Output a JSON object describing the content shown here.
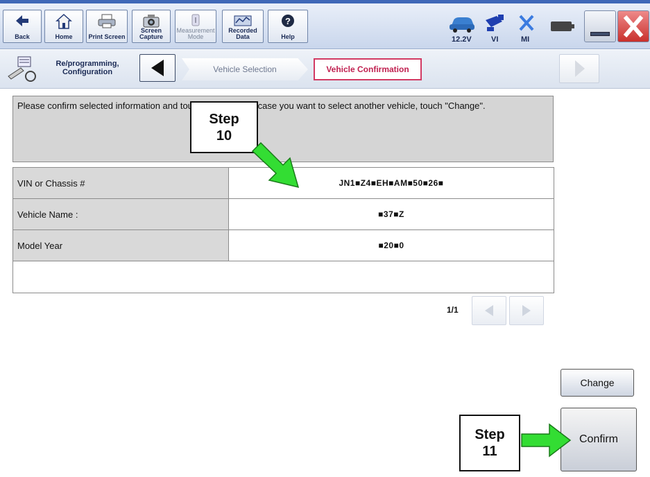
{
  "toolbar": {
    "buttons": [
      {
        "label": "Back",
        "icon": "back-arrow-icon"
      },
      {
        "label": "Home",
        "icon": "home-icon"
      },
      {
        "label": "Print Screen",
        "icon": "printer-icon"
      },
      {
        "label": "Screen Capture",
        "icon": "camera-icon"
      },
      {
        "label": "Measurement Mode",
        "icon": "gauge-icon",
        "disabled": true
      },
      {
        "label": "Recorded Data",
        "icon": "recorded-data-icon"
      },
      {
        "label": "Help",
        "icon": "help-icon"
      }
    ],
    "voltage": "12.2V",
    "vi_label": "VI",
    "mi_label": "MI"
  },
  "breadcrumb": {
    "repro_label": "Re/programming, Configuration",
    "vehicle_selection": "Vehicle Selection",
    "vehicle_confirmation": "Vehicle Confirmation"
  },
  "main": {
    "message": "Please confirm selected information and touch \"Confirm\". In case you want to select another vehicle, touch \"Change\".",
    "rows": [
      {
        "label": "VIN or Chassis #",
        "value": "JN1■Z4■EH■AM■50■26■"
      },
      {
        "label": "Vehicle Name :",
        "value": "■37■Z"
      },
      {
        "label": "Model Year",
        "value": "■20■0"
      }
    ],
    "pager": "1/1"
  },
  "buttons": {
    "change": "Change",
    "confirm": "Confirm"
  },
  "callouts": {
    "step10_line1": "Step",
    "step10_line2": "10",
    "step11_line1": "Step",
    "step11_line2": "11"
  },
  "colors": {
    "accent": "#d23a63",
    "arrow": "#33dd33",
    "titlebar": "#3f68b8"
  }
}
